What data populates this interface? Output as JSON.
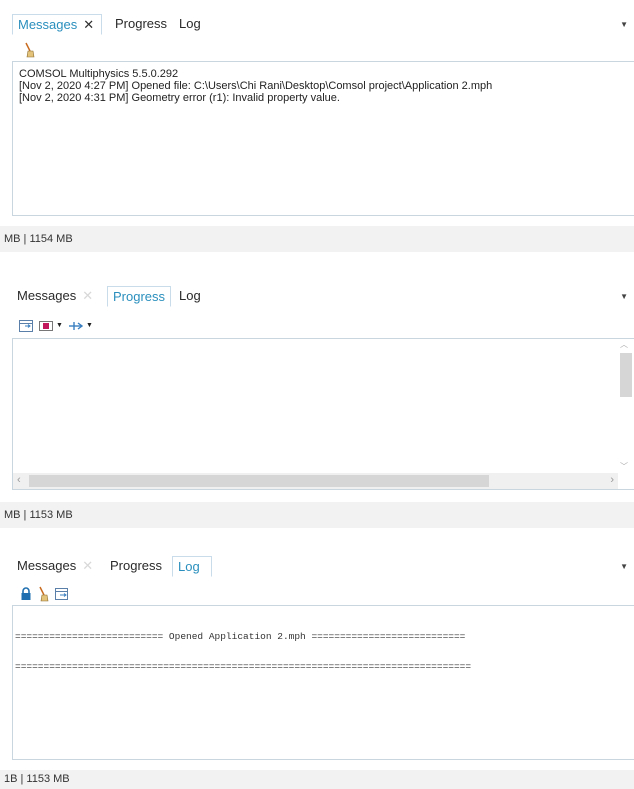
{
  "panels": [
    {
      "tabs": [
        "Messages",
        "Progress",
        "Log"
      ],
      "active_tab": "Messages",
      "close_glyph": "✕",
      "menu_glyph": "▼",
      "toolbar": [
        "broom-icon"
      ],
      "messages": [
        "COMSOL Multiphysics 5.5.0.292",
        "[Nov 2, 2020 4:27 PM] Opened file: C:\\Users\\Chi Rani\\Desktop\\Comsol project\\Application 2.mph",
        "[Nov 2, 2020 4:31 PM] Geometry error (r1): Invalid property value."
      ],
      "status": "MB | 1154 MB"
    },
    {
      "tabs": [
        "Messages",
        "Progress",
        "Log"
      ],
      "active_tab": "Progress",
      "close_glyph": "✕",
      "menu_glyph": "▼",
      "toolbar": [
        "expand-table-icon",
        "progress-bar-icon",
        "dropdown-arrow",
        "step-icon",
        "dropdown-arrow"
      ],
      "status": "MB | 1153 MB"
    },
    {
      "tabs": [
        "Messages",
        "Progress",
        "Log"
      ],
      "active_tab": "Log",
      "close_glyph": "✕",
      "menu_glyph": "▼",
      "toolbar": [
        "lock-icon",
        "broom-icon",
        "export-icon"
      ],
      "log_lines": [
        "========================== Opened Application 2.mph ===========================",
        "================================================================================"
      ],
      "status": "1B | 1153 MB"
    }
  ],
  "colors": {
    "accent": "#2a8fbd",
    "border": "#c9d6e0",
    "status_bg": "#f2f2f2"
  }
}
